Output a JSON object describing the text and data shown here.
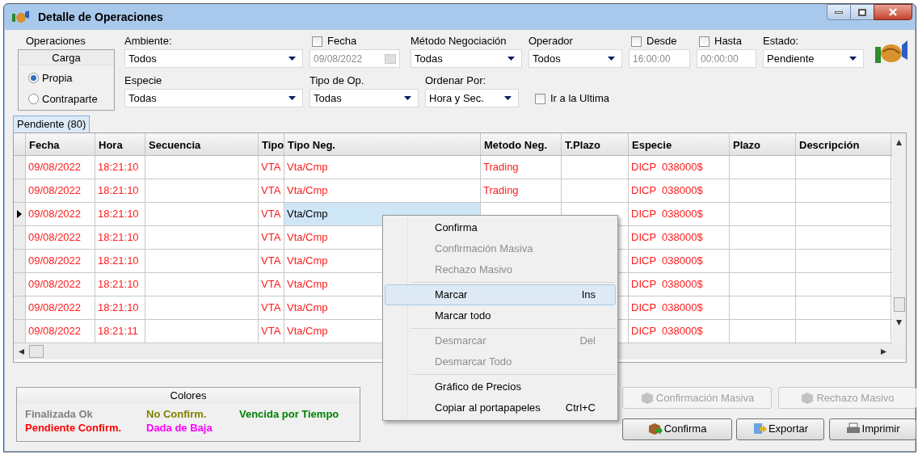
{
  "window": {
    "title": "Detalle de Operaciones"
  },
  "filters": {
    "operaciones_label": "Operaciones",
    "carga": {
      "title": "Carga",
      "options": [
        {
          "label": "Propia",
          "selected": true
        },
        {
          "label": "Contraparte",
          "selected": false
        }
      ]
    },
    "ambiente": {
      "label": "Ambiente:",
      "value": "Todos"
    },
    "fecha": {
      "label": "Fecha",
      "checked": false,
      "value": "09/08/2022"
    },
    "metodo": {
      "label": "Método Negociación",
      "value": "Todas"
    },
    "operador": {
      "label": "Operador",
      "value": "Todos"
    },
    "desde": {
      "label": "Desde",
      "checked": false,
      "value": "16:00:00"
    },
    "hasta": {
      "label": "Hasta",
      "checked": false,
      "value": "00:00:00"
    },
    "estado": {
      "label": "Estado:",
      "value": "Pendiente"
    },
    "especie": {
      "label": "Especie",
      "value": "Todas"
    },
    "tipo_op": {
      "label": "Tipo de Op.",
      "value": "Todas"
    },
    "ordenar": {
      "label": "Ordenar Por:",
      "value": "Hora y Sec."
    },
    "ir_ultima": {
      "label": "Ir a la Ultima",
      "checked": false
    }
  },
  "tabs": [
    {
      "label": "Pendiente (80)",
      "selected": true
    }
  ],
  "table": {
    "columns": [
      "Fecha",
      "Hora",
      "Secuencia",
      "Tipo",
      "Tipo Neg.",
      "Metodo Neg.",
      "T.Plazo",
      "Especie",
      "Plazo",
      "Descripción"
    ],
    "rows": [
      {
        "fecha": "09/08/2022",
        "hora": "18:21:10",
        "tipo": "VTA",
        "tipo_neg": "Vta/Cmp",
        "metodo": "Trading",
        "especie": "DICP  038000$",
        "selected": false
      },
      {
        "fecha": "09/08/2022",
        "hora": "18:21:10",
        "tipo": "VTA",
        "tipo_neg": "Vta/Cmp",
        "metodo": "Trading",
        "especie": "DICP  038000$",
        "selected": false
      },
      {
        "fecha": "09/08/2022",
        "hora": "18:21:10",
        "tipo": "VTA",
        "tipo_neg": "Vta/Cmp",
        "especie": "DICP  038000$",
        "selected": true
      },
      {
        "fecha": "09/08/2022",
        "hora": "18:21:10",
        "tipo": "VTA",
        "tipo_neg": "Vta/Cmp",
        "especie": "DICP  038000$",
        "selected": false
      },
      {
        "fecha": "09/08/2022",
        "hora": "18:21:10",
        "tipo": "VTA",
        "tipo_neg": "Vta/Cmp",
        "especie": "DICP  038000$",
        "selected": false
      },
      {
        "fecha": "09/08/2022",
        "hora": "18:21:10",
        "tipo": "VTA",
        "tipo_neg": "Vta/Cmp",
        "especie": "DICP  038000$",
        "selected": false
      },
      {
        "fecha": "09/08/2022",
        "hora": "18:21:10",
        "tipo": "VTA",
        "tipo_neg": "Vta/Cmp",
        "especie": "DICP  038000$",
        "selected": false
      },
      {
        "fecha": "09/08/2022",
        "hora": "18:21:11",
        "tipo": "VTA",
        "tipo_neg": "Vta/Cmp",
        "especie": "DICP  038000$",
        "selected": false
      }
    ]
  },
  "legend": {
    "title": "Colores",
    "items": [
      {
        "label": "Finalizada Ok",
        "color": "#808080"
      },
      {
        "label": "No Confirm.",
        "color": "#808000"
      },
      {
        "label": "Vencida por Tiempo",
        "color": "#008000"
      },
      {
        "label": "Pendiente Confirm.",
        "color": "#ff0000"
      },
      {
        "label": "Dada de Baja",
        "color": "#ff00ff"
      }
    ]
  },
  "buttons": [
    {
      "label": "Confirmación Masiva",
      "disabled": true
    },
    {
      "label": "Rechazo Masivo",
      "disabled": true
    },
    {
      "label": "Confirma",
      "disabled": false
    },
    {
      "label": "Exportar",
      "disabled": false
    },
    {
      "label": "Imprimir",
      "disabled": false
    }
  ],
  "context_menu": [
    {
      "kind": "item",
      "label": "Confirma",
      "disabled": false,
      "selected": false
    },
    {
      "kind": "item",
      "label": "Confirmación Masiva",
      "disabled": true,
      "selected": false
    },
    {
      "kind": "item",
      "label": "Rechazo Masivo",
      "disabled": true,
      "selected": false
    },
    {
      "kind": "separator"
    },
    {
      "kind": "item",
      "label": "Marcar",
      "shortcut": "Ins",
      "disabled": false,
      "selected": true
    },
    {
      "kind": "item",
      "label": "Marcar todo",
      "disabled": false,
      "selected": false
    },
    {
      "kind": "separator"
    },
    {
      "kind": "item",
      "label": "Desmarcar",
      "shortcut": "Del",
      "disabled": true,
      "selected": false
    },
    {
      "kind": "item",
      "label": "Desmarcar Todo",
      "disabled": true,
      "selected": false
    },
    {
      "kind": "separator"
    },
    {
      "kind": "item",
      "label": "Gráfico de Precios",
      "disabled": false,
      "selected": false
    },
    {
      "kind": "item",
      "label": "Copiar al portapapeles",
      "shortcut": "Ctrl+C",
      "disabled": false,
      "selected": false
    }
  ]
}
